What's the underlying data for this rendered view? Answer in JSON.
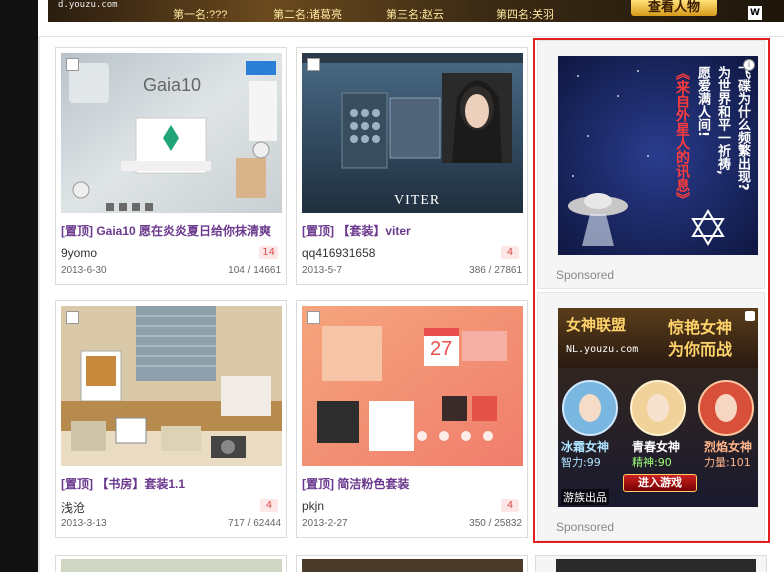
{
  "banner": {
    "site": "d.youzu.com",
    "ranks": [
      "第一名:???",
      "第二名:诸葛亮",
      "第三名:赵云",
      "第四名:关羽"
    ],
    "view_button": "查看人物",
    "corner_letter": "W"
  },
  "cards": [
    {
      "title": "[置顶] Gaia10 愿在炎炎夏日给你抹清爽",
      "author": "9yomo",
      "comments": "14",
      "date": "2013-6-30",
      "stats": "104 / 14661",
      "thumb_label": "Gaia10"
    },
    {
      "title": "[置顶] 【套装】viter",
      "author": "qq416931658",
      "comments": "4",
      "date": "2013-5-7",
      "stats": "386 / 27861",
      "thumb_label": "VITER"
    },
    {
      "title": "[置顶] 【书房】套装1.1",
      "author": "浅沧",
      "comments": "4",
      "date": "2013-3-13",
      "stats": "717 / 62444",
      "thumb_label": ""
    },
    {
      "title": "[置顶] 简洁粉色套装",
      "author": "pkjn",
      "comments": "4",
      "date": "2013-2-27",
      "stats": "350 / 25832",
      "thumb_label": "27"
    }
  ],
  "ads": [
    {
      "lines": [
        "飞碟为什么频繁出现?",
        "为世界和平一祈祷,",
        "愿爱满人间!",
        "《来自外星人的讯息》"
      ],
      "sponsored": "Sponsored",
      "info_icon": "i"
    },
    {
      "logo": "女神联盟",
      "logo_url": "NL.youzu.com",
      "headline": [
        "惊艳女神",
        "为你而战"
      ],
      "goddesses": [
        {
          "name": "冰霜女神",
          "stat": "智力:99"
        },
        {
          "name": "青春女神",
          "stat": "精神:90"
        },
        {
          "name": "烈焰女神",
          "stat": "力量:101"
        }
      ],
      "publisher": "游族出品",
      "cta": "进入游戏",
      "sponsored": "Sponsored"
    }
  ]
}
